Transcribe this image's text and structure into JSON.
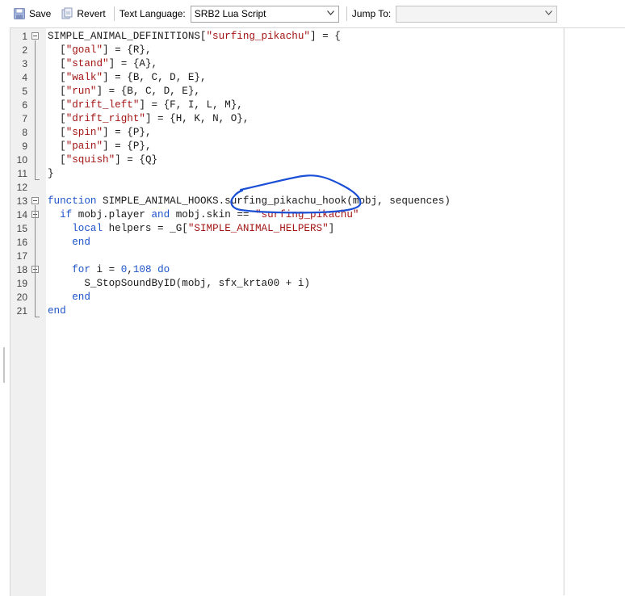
{
  "toolbar": {
    "save_label": "Save",
    "revert_label": "Revert",
    "text_language_label": "Text Language:",
    "text_language_value": "SRB2 Lua Script",
    "jump_to_label": "Jump To:",
    "jump_to_value": ""
  },
  "editor": {
    "lines": [
      {
        "n": "1",
        "tokens": [
          {
            "t": "SIMPLE_ANIMAL_DEFINITIONS[",
            "c": ""
          },
          {
            "t": "\"surfing_pikachu\"",
            "c": "str"
          },
          {
            "t": "] = {",
            "c": ""
          }
        ]
      },
      {
        "n": "2",
        "tokens": [
          {
            "t": "  [",
            "c": ""
          },
          {
            "t": "\"goal\"",
            "c": "str"
          },
          {
            "t": "] = {R},",
            "c": ""
          }
        ]
      },
      {
        "n": "3",
        "tokens": [
          {
            "t": "  [",
            "c": ""
          },
          {
            "t": "\"stand\"",
            "c": "str"
          },
          {
            "t": "] = {A},",
            "c": ""
          }
        ]
      },
      {
        "n": "4",
        "tokens": [
          {
            "t": "  [",
            "c": ""
          },
          {
            "t": "\"walk\"",
            "c": "str"
          },
          {
            "t": "] = {B, C, D, E},",
            "c": ""
          }
        ]
      },
      {
        "n": "5",
        "tokens": [
          {
            "t": "  [",
            "c": ""
          },
          {
            "t": "\"run\"",
            "c": "str"
          },
          {
            "t": "] = {B, C, D, E},",
            "c": ""
          }
        ]
      },
      {
        "n": "6",
        "tokens": [
          {
            "t": "  [",
            "c": ""
          },
          {
            "t": "\"drift_left\"",
            "c": "str"
          },
          {
            "t": "] = {F, I, L, M},",
            "c": ""
          }
        ]
      },
      {
        "n": "7",
        "tokens": [
          {
            "t": "  [",
            "c": ""
          },
          {
            "t": "\"drift_right\"",
            "c": "str"
          },
          {
            "t": "] = {H, K, N, O},",
            "c": ""
          }
        ]
      },
      {
        "n": "8",
        "tokens": [
          {
            "t": "  [",
            "c": ""
          },
          {
            "t": "\"spin\"",
            "c": "str"
          },
          {
            "t": "] = {P},",
            "c": ""
          }
        ]
      },
      {
        "n": "9",
        "tokens": [
          {
            "t": "  [",
            "c": ""
          },
          {
            "t": "\"pain\"",
            "c": "str"
          },
          {
            "t": "] = {P},",
            "c": ""
          }
        ]
      },
      {
        "n": "10",
        "tokens": [
          {
            "t": "  [",
            "c": ""
          },
          {
            "t": "\"squish\"",
            "c": "str"
          },
          {
            "t": "] = {Q}",
            "c": ""
          }
        ]
      },
      {
        "n": "11",
        "tokens": [
          {
            "t": "}",
            "c": ""
          }
        ]
      },
      {
        "n": "12",
        "tokens": []
      },
      {
        "n": "13",
        "tokens": [
          {
            "t": "function",
            "c": "kw"
          },
          {
            "t": " SIMPLE_ANIMAL_HOOKS.surfing_pikachu_hook(mobj, sequences)",
            "c": ""
          }
        ]
      },
      {
        "n": "14",
        "tokens": [
          {
            "t": "  ",
            "c": ""
          },
          {
            "t": "if",
            "c": "kw"
          },
          {
            "t": " mobj.player ",
            "c": ""
          },
          {
            "t": "and",
            "c": "kw"
          },
          {
            "t": " mobj.skin == ",
            "c": ""
          },
          {
            "t": "\"surfing_pikachu\"",
            "c": "str"
          }
        ]
      },
      {
        "n": "15",
        "tokens": [
          {
            "t": "    ",
            "c": ""
          },
          {
            "t": "local",
            "c": "kw"
          },
          {
            "t": " helpers = _G[",
            "c": ""
          },
          {
            "t": "\"SIMPLE_ANIMAL_HELPERS\"",
            "c": "str"
          },
          {
            "t": "]",
            "c": ""
          }
        ]
      },
      {
        "n": "16",
        "tokens": [
          {
            "t": "    ",
            "c": ""
          },
          {
            "t": "end",
            "c": "kw"
          }
        ]
      },
      {
        "n": "17",
        "tokens": []
      },
      {
        "n": "18",
        "tokens": [
          {
            "t": "    ",
            "c": ""
          },
          {
            "t": "for",
            "c": "kw"
          },
          {
            "t": " i = ",
            "c": ""
          },
          {
            "t": "0",
            "c": "kw"
          },
          {
            "t": ",",
            "c": ""
          },
          {
            "t": "108",
            "c": "kw"
          },
          {
            "t": " ",
            "c": ""
          },
          {
            "t": "do",
            "c": "kw"
          }
        ]
      },
      {
        "n": "19",
        "tokens": [
          {
            "t": "      S_StopSoundByID(mobj, sfx_krta00 + i)",
            "c": ""
          }
        ]
      },
      {
        "n": "20",
        "tokens": [
          {
            "t": "    ",
            "c": ""
          },
          {
            "t": "end",
            "c": "kw"
          }
        ]
      },
      {
        "n": "21",
        "tokens": [
          {
            "t": "end",
            "c": "kw"
          }
        ]
      }
    ]
  },
  "colors": {
    "keyword": "#1d53c8",
    "string": "#a31515",
    "annotation": "#1a4fd6"
  },
  "icons": [
    "save-icon",
    "revert-icon",
    "chevron-down-icon"
  ]
}
